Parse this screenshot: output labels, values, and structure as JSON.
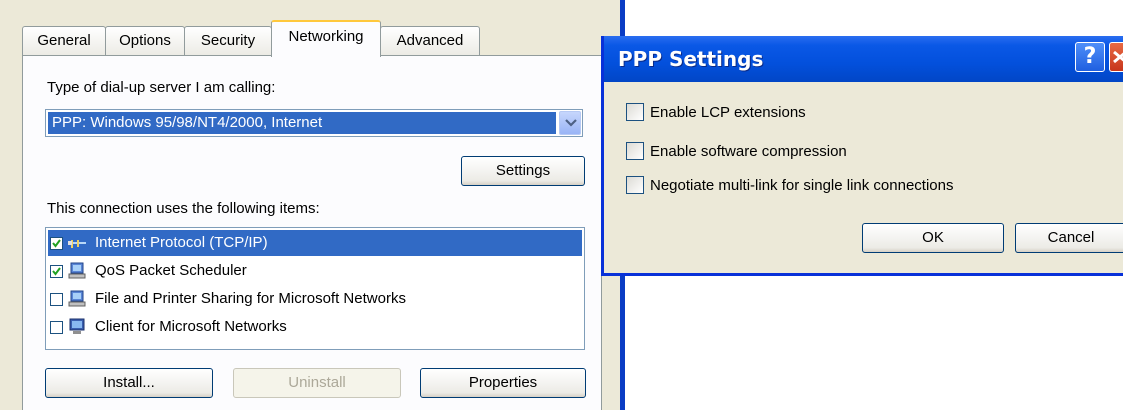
{
  "tabs": [
    "General",
    "Options",
    "Security",
    "Networking",
    "Advanced"
  ],
  "networking": {
    "server_type_label": "Type of dial-up server I am calling:",
    "server_type_value": "PPP: Windows 95/98/NT4/2000, Internet",
    "settings_button": "Settings",
    "items_label": "This connection uses the following items:",
    "items": [
      {
        "label": "Internet Protocol (TCP/IP)",
        "checked": true,
        "icon": "network-protocol-icon",
        "selected": true
      },
      {
        "label": "QoS Packet Scheduler",
        "checked": true,
        "icon": "network-service-icon",
        "selected": false
      },
      {
        "label": "File and Printer Sharing for Microsoft Networks",
        "checked": false,
        "icon": "network-service-icon",
        "selected": false
      },
      {
        "label": "Client for Microsoft Networks",
        "checked": false,
        "icon": "network-client-icon",
        "selected": false
      }
    ],
    "install_button": "Install...",
    "uninstall_button": "Uninstall",
    "properties_button": "Properties"
  },
  "ppp_dialog": {
    "title": "PPP Settings",
    "help_glyph": "?",
    "options": [
      {
        "label": "Enable LCP extensions",
        "checked": false
      },
      {
        "label": "Enable software compression",
        "checked": false
      },
      {
        "label": "Negotiate multi-link for single link connections",
        "checked": false
      }
    ],
    "ok_button": "OK",
    "cancel_button": "Cancel"
  },
  "colors": {
    "selection": "#316ac5",
    "titlebar": "#0350dc",
    "dialog_face": "#ece9d8",
    "active_tab_accent": "#ffc83c"
  }
}
